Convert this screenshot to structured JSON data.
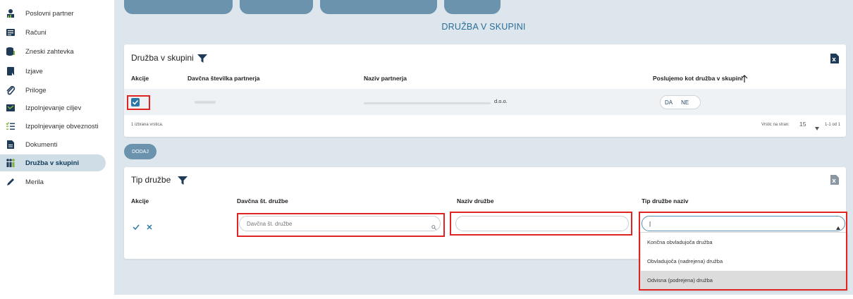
{
  "sidebar": {
    "items": [
      {
        "label": "Poslovni partner",
        "icon": "person-chart-icon"
      },
      {
        "label": "Računi",
        "icon": "list-icon"
      },
      {
        "label": "Zneski zahtevka",
        "icon": "coins-icon"
      },
      {
        "label": "Izjave",
        "icon": "document-icon"
      },
      {
        "label": "Priloge",
        "icon": "paperclip-icon"
      },
      {
        "label": "Izpolnjevanje ciljev",
        "icon": "target-icon"
      },
      {
        "label": "Izpolnjevanje obveznosti",
        "icon": "checklist-icon"
      },
      {
        "label": "Dokumenti",
        "icon": "file-icon"
      },
      {
        "label": "Družba v skupini",
        "icon": "people-group-icon",
        "active": true
      },
      {
        "label": "Merila",
        "icon": "pencil-icon"
      }
    ]
  },
  "page": {
    "title": "DRUŽBA V SKUPINI"
  },
  "group_card": {
    "title": "Družba v skupini",
    "headers": {
      "actions": "Akcije",
      "tax_number": "Davčna številka partnerja",
      "partner_name": "Naziv partnerja",
      "group_flag": "Poslujemo kot družba v skupini"
    },
    "row": {
      "partner_name_suffix": "d.o.o.",
      "yes": "DA",
      "no": "NE"
    },
    "footer": {
      "selected": "1 izbrana vrstica.",
      "per_page_label": "Vrstic na stran:",
      "per_page_value": "15",
      "range": "1-1 od 1"
    }
  },
  "add_button": {
    "label": "DODAJ"
  },
  "type_card": {
    "title": "Tip družbe",
    "headers": {
      "actions": "Akcije",
      "tax_number": "Davčna št. družbe",
      "name": "Naziv družbe",
      "type_name": "Tip družbe naziv"
    },
    "inputs": {
      "tax_placeholder": "Davčna št. družbe",
      "name_value": "",
      "type_value": "|"
    },
    "dropdown_options": [
      "Končna obvladujoča družba",
      "Obvladujoča (nadrejena) družba",
      "Odvisna (podrejena) družba"
    ]
  },
  "colors": {
    "accent": "#2b78a8",
    "highlight": "#e02424",
    "main_bg": "#dde6ec",
    "sidebar_active": "#cfdde6"
  }
}
